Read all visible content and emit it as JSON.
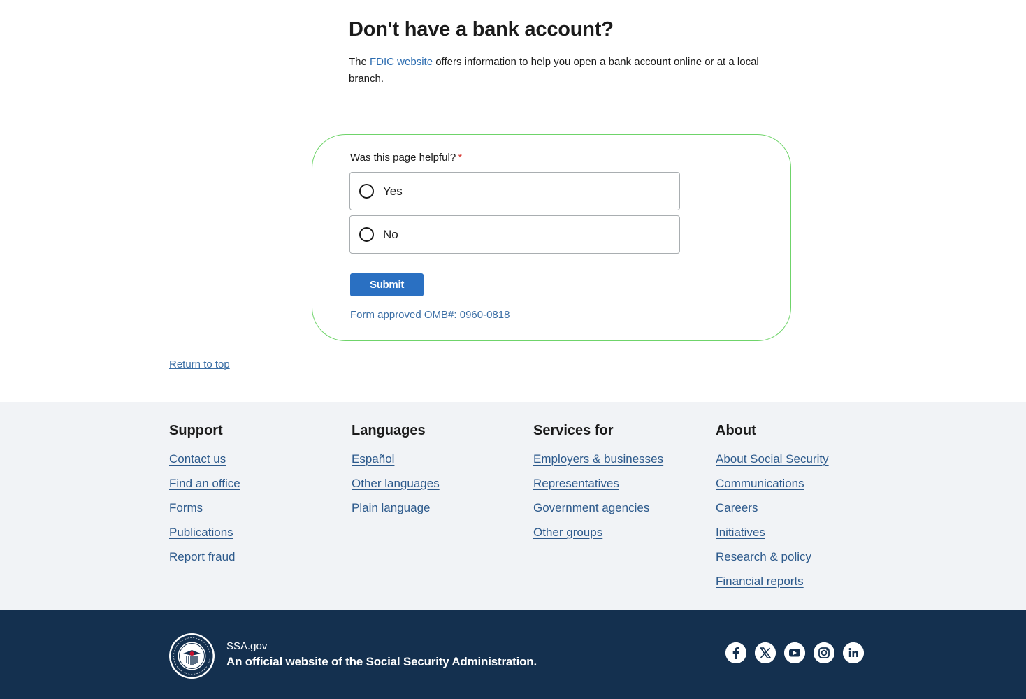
{
  "main": {
    "heading": "Don't have a bank account?",
    "intro_before": "The ",
    "intro_link": "FDIC website",
    "intro_after": " offers information to help you open a bank account online or at a local branch."
  },
  "feedback": {
    "question": "Was this page helpful?",
    "required_marker": "*",
    "options": [
      "Yes",
      "No"
    ],
    "submit_label": "Submit",
    "omb_link": "Form approved OMB#: 0960-0818"
  },
  "return_to_top": "Return to top",
  "footer": {
    "columns": [
      {
        "heading": "Support",
        "links": [
          "Contact us",
          "Find an office",
          "Forms",
          "Publications",
          "Report fraud"
        ]
      },
      {
        "heading": "Languages",
        "links": [
          "Español",
          "Other languages",
          "Plain language"
        ]
      },
      {
        "heading": "Services for",
        "links": [
          "Employers & businesses",
          "Representatives",
          "Government agencies",
          "Other groups"
        ]
      },
      {
        "heading": "About",
        "links": [
          "About Social Security",
          "Communications",
          "Careers",
          "Initiatives",
          "Research & policy",
          "Financial reports"
        ]
      }
    ],
    "site_name": "SSA.gov",
    "official_text": "An official website of the Social Security Administration.",
    "social_icons": [
      "facebook-icon",
      "x-icon",
      "youtube-icon",
      "instagram-icon",
      "linkedin-icon"
    ]
  },
  "colors": {
    "link": "#2d5a8c",
    "submit_bg": "#2a70c2",
    "feedback_border": "#6fd46a",
    "footer_light_bg": "#f1f3f6",
    "footer_dark_bg": "#14304f",
    "required": "#d83933"
  }
}
